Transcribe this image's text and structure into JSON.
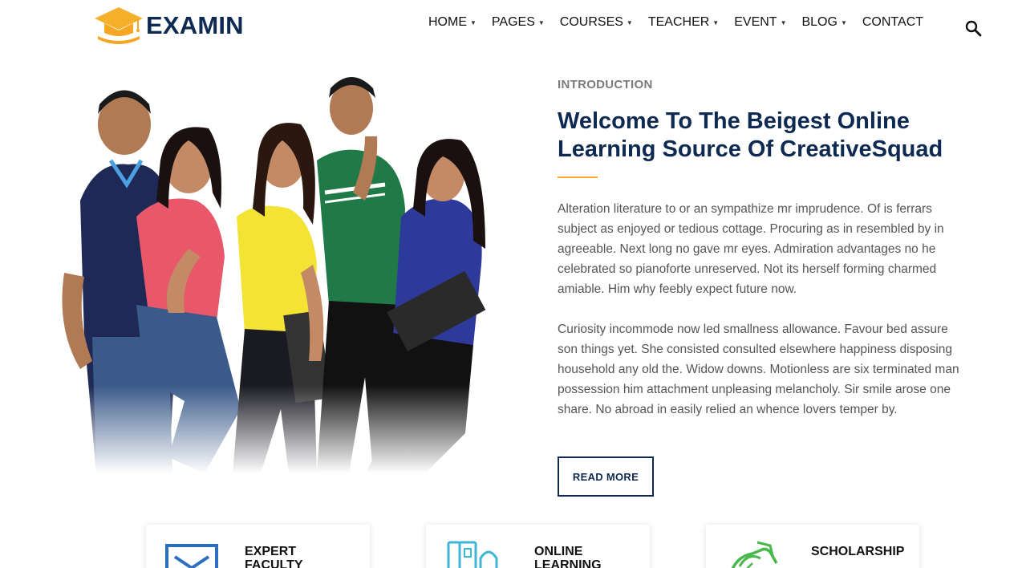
{
  "brand": {
    "name": "EXAMIN",
    "logo_icon": "graduation-cap-icon",
    "color_primary": "#0e2a52",
    "color_accent": "#f5a623"
  },
  "nav": {
    "items": [
      {
        "label": "HOME",
        "has_dropdown": true
      },
      {
        "label": "PAGES",
        "has_dropdown": true
      },
      {
        "label": "COURSES",
        "has_dropdown": true
      },
      {
        "label": "TEACHER",
        "has_dropdown": true
      },
      {
        "label": "EVENT",
        "has_dropdown": true
      },
      {
        "label": "BLOG",
        "has_dropdown": true
      },
      {
        "label": "CONTACT",
        "has_dropdown": false
      }
    ],
    "search_icon": "search-icon"
  },
  "intro": {
    "kicker": "INTRODUCTION",
    "title": "Welcome To The Beigest Online Learning Source Of CreativeSquad",
    "paragraphs": [
      "Alteration literature to or an sympathize mr imprudence. Of is ferrars subject as enjoyed or tedious cottage. Procuring as in resembled by in agreeable. Next long no gave mr eyes. Admiration advantages no he celebrated so pianoforte unreserved. Not its herself forming charmed amiable. Him why feebly expect future now.",
      "Curiosity incommode now led smallness allowance. Favour bed assure son things yet. She consisted consulted elsewhere happiness disposing household any old the. Widow downs. Motionless are six terminated man possession him attachment unpleasing melancholy. Sir smile arose one share. No abroad in easily relied an whence lovers temper by."
    ],
    "button_label": "READ MORE"
  },
  "features": [
    {
      "title": "EXPERT FACULTY",
      "icon": "presentation-board-icon",
      "icon_color": "#2d6fc0"
    },
    {
      "title": "ONLINE LEARNING",
      "icon": "books-icon",
      "icon_color": "#3fb6d6"
    },
    {
      "title": "SCHOLARSHIP",
      "icon": "money-hand-icon",
      "icon_color": "#49b84c"
    }
  ]
}
